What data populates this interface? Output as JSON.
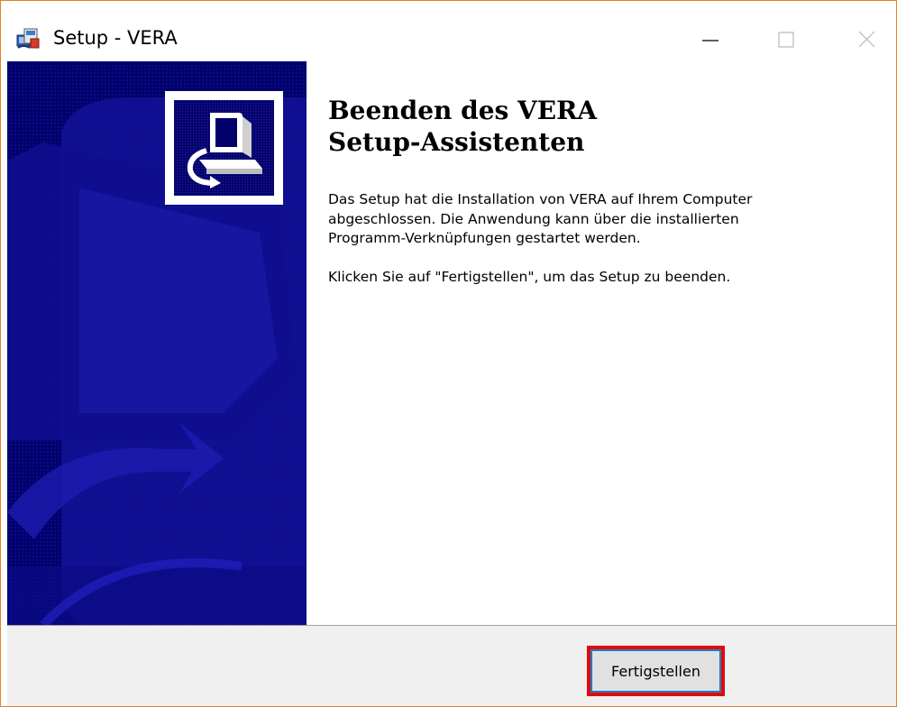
{
  "window": {
    "title": "Setup - VERA",
    "border_color": "#e0822a",
    "controls": {
      "minimize_icon": "minimize-icon",
      "maximize_icon": "maximize-icon",
      "close_icon": "close-icon"
    }
  },
  "app_icon": "installer-icon",
  "side_panel": {
    "background_color": "#01006b",
    "logo_icon": "computer-install-icon"
  },
  "content": {
    "heading_line1": "Beenden des VERA",
    "heading_line2": "Setup-Assistenten",
    "paragraph1_line1": "Das Setup hat die Installation von VERA auf Ihrem Computer",
    "paragraph1_line2": "abgeschlossen. Die Anwendung kann über die installierten",
    "paragraph1_line3": "Programm-Verknüpfungen gestartet werden.",
    "paragraph2": "Klicken Sie auf \"Fertigstellen\", um das Setup zu beenden."
  },
  "footer": {
    "finish_button_label": "Fertigstellen",
    "highlight_color": "#e00a0a"
  }
}
